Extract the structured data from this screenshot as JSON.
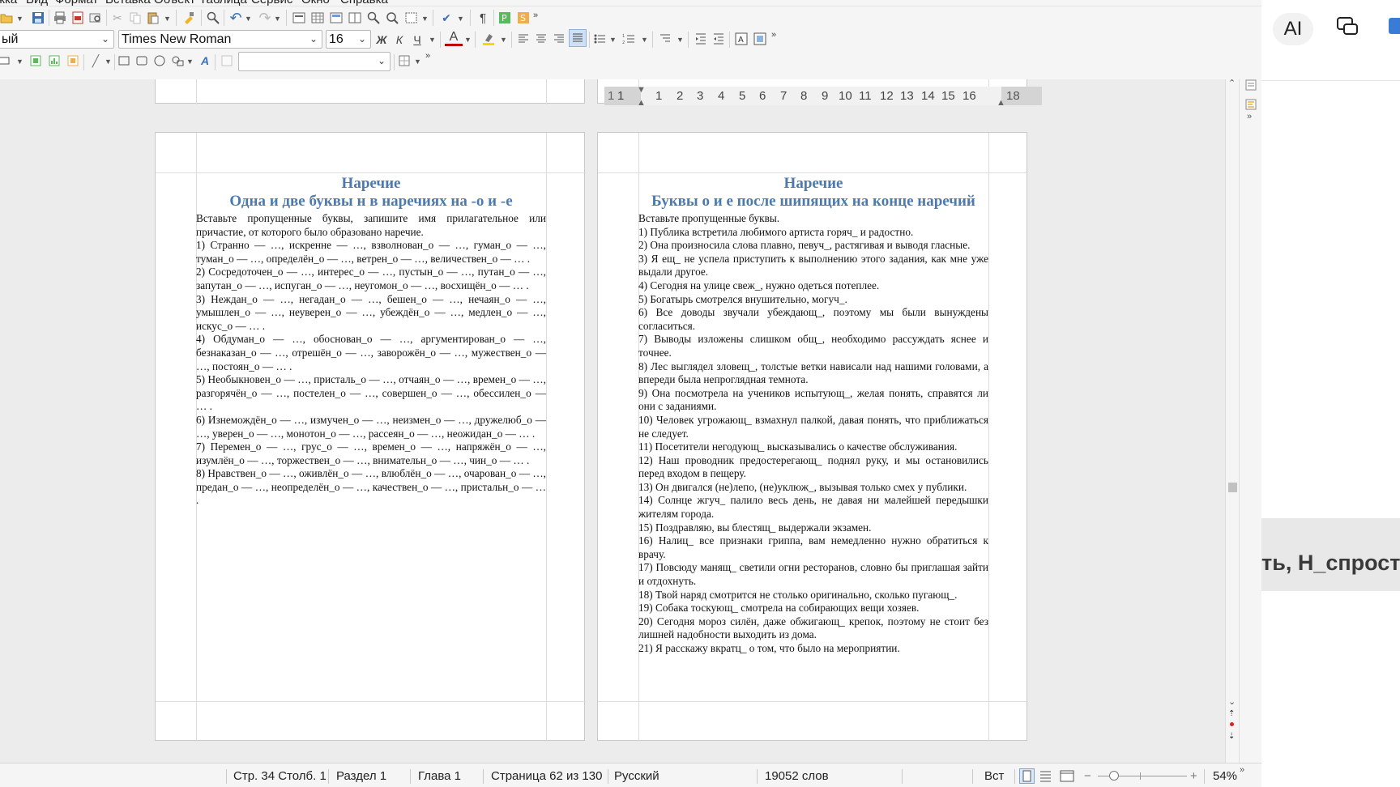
{
  "menubar": {
    "items": [
      "жка",
      "Вид",
      "Формат",
      "Вставка",
      "Объект",
      "Таблица",
      "Сервис",
      "Окно",
      "Справка"
    ]
  },
  "format_bar": {
    "paragraph_style": "ый",
    "font_name": "Times New Roman",
    "font_size": "16",
    "bold_label": "Ж",
    "italic_label": "К",
    "underline_label": "Ч",
    "font_color_label": "А",
    "colors": {
      "font_color": "#c00000",
      "highlight_color": "#ffd500"
    }
  },
  "drawing_bar": {
    "style_box_value": ""
  },
  "ruler": {
    "marks": [
      "1",
      "1",
      "1",
      "2",
      "3",
      "4",
      "5",
      "6",
      "7",
      "8",
      "9",
      "10",
      "11",
      "12",
      "13",
      "14",
      "15",
      "16",
      "18"
    ]
  },
  "page_left": {
    "title_1": "Наречие",
    "title_2": "Одна и две буквы н в наречиях на -о и -е",
    "paragraphs": [
      "Вставьте пропущенные буквы, запишите имя прилагательное или причастие, от которого было образовано наречие.",
      "1) Странно — …, искренне — …, взволнован_о — …, гуман_о — …, туман_о — …, определён_о — …, ветрен_о — …, величествен_о — … .",
      "2) Сосредоточен_о — …, интерес_о — …, пустын_о — …, путан_о — …, запутан_о — …, испуган_о — …, неугомон_о — …, восхищён_о — … .",
      "3) Неждан_о — …, негадан_о — …, бешен_о — …, нечаян_о — …, умышлен_о — …, неуверен_о — …, убеждён_о — …, медлен_о — …, искус_о — … .",
      "4) Обдуман_о — …, обоснован_о — …, аргументирован_о — …, безнаказан_о — …, отрешён_о — …, заворожён_о — …, мужествен_о — …, постоян_о — … .",
      "5) Необыкновен_о — …, присталь_о — …, отчаян_о — …, времен_о — …, разгорячён_о — …, постелен_о — …, совершен_о — …, обессилен_о — … .",
      "6) Изнемождён_о — …, измучен_о — …, неизмен_о — …, дружелюб_о — …, уверен_о — …, монотон_о — …, рассеян_о — …, неожидан_о — … .",
      "7) Перемен_о — …, грус_о — …, времен_о — …, напряжён_о — …, изумлён_о — …, торжествен_о — …, внимательн_о — …, чин_о — … .",
      "8) Нравствен_о — …, оживлён_о — …, влюблён_о — …, очарован_о — …, предан_о — …, неопределён_о — …, качествен_о — …, пристальн_о — … ."
    ]
  },
  "page_right": {
    "title_1": "Наречие",
    "title_2": "Буквы о и е после шипящих на конце наречий",
    "paragraphs": [
      "Вставьте пропущенные буквы.",
      "1) Публика встретила любимого артиста горяч_ и радостно.",
      "2) Она произносила слова плавно, певуч_, растягивая и выводя гласные.",
      "3) Я ещ_ не успела приступить к выполнению этого задания, как мне уже выдали другое.",
      "4) Сегодня на улице свеж_, нужно одеться потеплее.",
      "5) Богатырь смотрелся внушительно, могуч_.",
      "6) Все доводы звучали убеждающ_, поэтому мы были вынуждены согласиться.",
      "7) Выводы изложены слишком общ_, необходимо рассуждать яснее и точнее.",
      "8) Лес выглядел зловещ_, толстые ветки нависали над нашими головами, а впереди была непроглядная темнота.",
      "9) Она посмотрела на учеников испытующ_, желая понять, справятся ли они с заданиями.",
      "10) Человек угрожающ_ взмахнул палкой, давая понять, что приближаться не следует.",
      "11) Посетители негодующ_ высказывались о качестве обслуживания.",
      "12) Наш проводник предостерегающ_ поднял руку, и мы остановились перед входом в пещеру.",
      "13) Он двигался (не)лепо, (не)уклюж_, вызывая только смех у публики.",
      "14) Солнце жгуч_ палило весь день, не давая ни малейшей передышки жителям города.",
      "15) Поздравляю, вы блестящ_ выдержали экзамен.",
      "16) Налиц_ все признаки гриппа, вам немедленно нужно обратиться к врачу.",
      "17) Повсюду манящ_ светили огни ресторанов, словно бы приглашая зайти и отдохнуть.",
      "18) Твой наряд смотрится не столько оригинально, сколько пугающ_.",
      "19) Собака тоскующ_ смотрела на собирающих вещи хозяев.",
      "20) Сегодня мороз силён, даже обжигающ_ крепок, поэтому не стоит без лишней надобности выходить из дома.",
      "21) Я расскажу вкратц_ о том, что было на мероприятии."
    ]
  },
  "statusbar": {
    "position": "Стр. 34 Столб. 1",
    "section": "Раздел 1",
    "chapter": "Глава 1",
    "page_of": "Страница 62 из 130",
    "language": "Русский",
    "word_count": "19052 слов",
    "insert_mode": "Вст",
    "zoom": "54%"
  },
  "side": {
    "ai_label": "AI",
    "overflow_text": "ть, Н_спроста,"
  }
}
